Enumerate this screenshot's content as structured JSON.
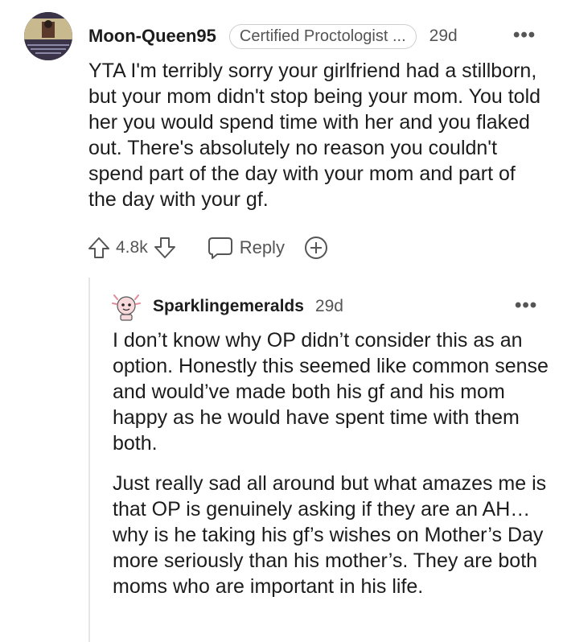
{
  "comment": {
    "username": "Moon-Queen95",
    "flair": "Certified Proctologist ...",
    "time": "29d",
    "more_label": "•••",
    "body": "YTA I'm terribly sorry your girlfriend had a stillborn, but your mom didn't stop being your mom. You told her you would spend time with her and you flaked out. There's absolutely no reason you couldn't spend part of the day with your mom and part of the day with your gf.",
    "vote_count": "4.8k",
    "reply_label": "Reply"
  },
  "reply": {
    "username": "Sparklingemeralds",
    "time": "29d",
    "more_label": "•••",
    "paragraphs": [
      "I don’t know why OP didn’t consider this as an option. Honestly this seemed like common sense and would’ve made both his gf and his mom happy as he would have spent time with them both.",
      "Just really sad all around but what amazes me is that OP is genuinely asking if they are an AH… why is he taking his gf’s wishes on Mother’s Day more seriously than his mother’s. They are both moms who are important in his life."
    ]
  },
  "icons": {
    "upvote": "upvote-arrow-icon",
    "downvote": "downvote-arrow-icon",
    "reply": "speech-bubble-icon",
    "expand": "plus-circle-icon",
    "more": "ellipsis-icon"
  },
  "colors": {
    "text": "#1c1c1c",
    "meta": "#555555",
    "border": "#cfcfcf",
    "thread_line": "#e6e6e6"
  }
}
